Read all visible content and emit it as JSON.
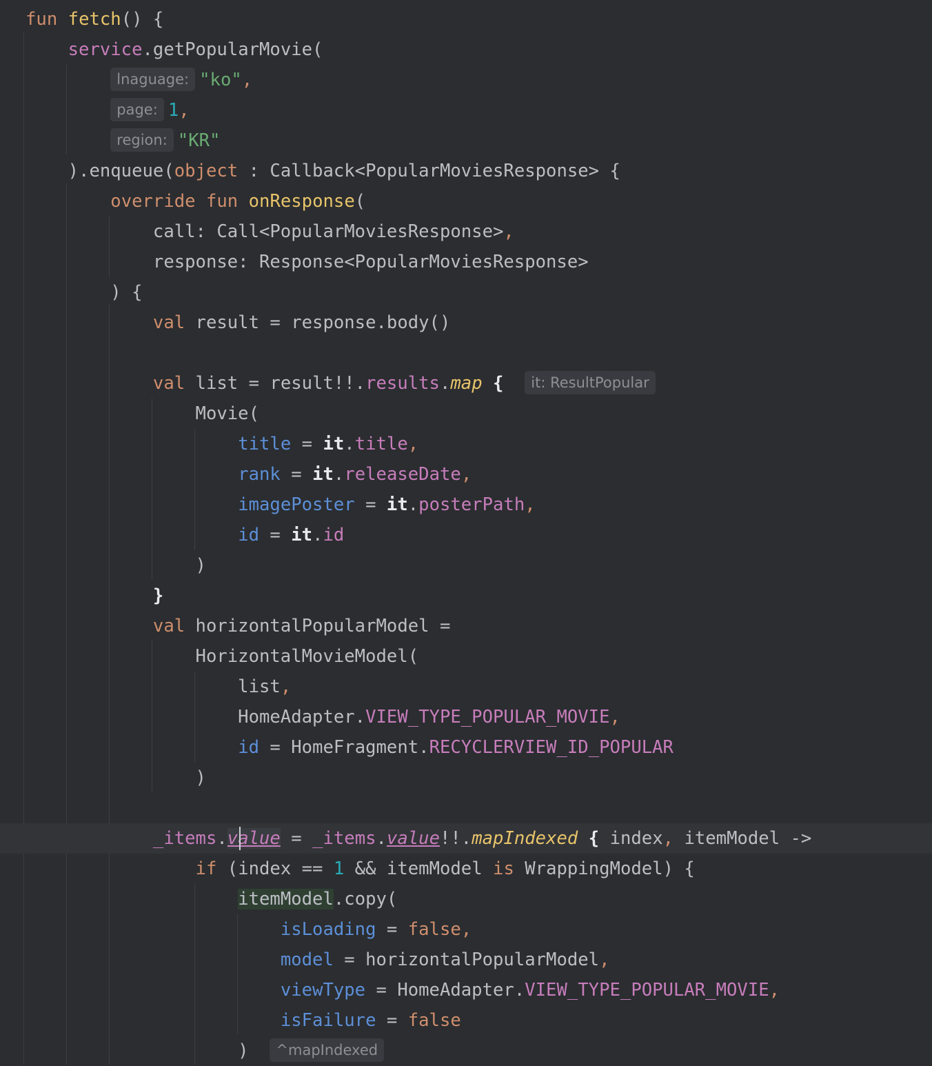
{
  "editor": {
    "language": "Kotlin",
    "theme": "dark",
    "colors": {
      "background": "#2b2d30",
      "keyword": "#cf8e6d",
      "function_declaration": "#e8c46a",
      "string": "#6aab73",
      "number": "#2aacb8",
      "property": "#c77dbb",
      "named_argument": "#5d8fd8",
      "inlay_hint_background": "#393b40"
    },
    "lines": [
      {
        "tokens": [
          {
            "t": "fun",
            "c": "k"
          },
          {
            "t": " "
          },
          {
            "t": "fetch",
            "c": "fd"
          },
          {
            "t": "() {"
          }
        ]
      },
      {
        "tokens": [
          {
            "t": "    "
          },
          {
            "t": "service",
            "c": "pp"
          },
          {
            "t": ".getPopularMovie("
          }
        ]
      },
      {
        "tokens": [
          {
            "t": "        "
          },
          {
            "t": "lnaguage:",
            "c": "hint"
          },
          {
            "t": "\"ko\"",
            "c": "s"
          },
          {
            "t": ",",
            "c": "k"
          }
        ]
      },
      {
        "tokens": [
          {
            "t": "        "
          },
          {
            "t": "page:",
            "c": "hint"
          },
          {
            "t": "1",
            "c": "n"
          },
          {
            "t": ",",
            "c": "k"
          }
        ]
      },
      {
        "tokens": [
          {
            "t": "        "
          },
          {
            "t": "region:",
            "c": "hint"
          },
          {
            "t": "\"KR\"",
            "c": "s"
          }
        ]
      },
      {
        "tokens": [
          {
            "t": "    ).enqueue("
          },
          {
            "t": "object",
            "c": "k"
          },
          {
            "t": " : Callback<PopularMoviesResponse> {"
          }
        ]
      },
      {
        "tokens": [
          {
            "t": "        "
          },
          {
            "t": "override",
            "c": "k"
          },
          {
            "t": " "
          },
          {
            "t": "fun",
            "c": "k"
          },
          {
            "t": " "
          },
          {
            "t": "onResponse",
            "c": "fd"
          },
          {
            "t": "("
          }
        ]
      },
      {
        "tokens": [
          {
            "t": "            call: Call<PopularMoviesResponse>"
          },
          {
            "t": ",",
            "c": "k"
          }
        ]
      },
      {
        "tokens": [
          {
            "t": "            response: Response<PopularMoviesResponse>"
          }
        ]
      },
      {
        "tokens": [
          {
            "t": "        ) {"
          }
        ]
      },
      {
        "tokens": [
          {
            "t": "            "
          },
          {
            "t": "val",
            "c": "k"
          },
          {
            "t": " result = response.body()"
          }
        ]
      },
      {
        "tokens": [
          {
            "t": ""
          }
        ]
      },
      {
        "tokens": [
          {
            "t": "            "
          },
          {
            "t": "val",
            "c": "k"
          },
          {
            "t": " list = result!!."
          },
          {
            "t": "results",
            "c": "pp"
          },
          {
            "t": "."
          },
          {
            "t": "map",
            "c": "ci"
          },
          {
            "t": " "
          },
          {
            "t": "{",
            "c": "it"
          },
          {
            "t": "  "
          },
          {
            "t": "it: ResultPopular",
            "c": "hint"
          }
        ]
      },
      {
        "tokens": [
          {
            "t": "                Movie("
          }
        ]
      },
      {
        "tokens": [
          {
            "t": "                    "
          },
          {
            "t": "title",
            "c": "pa"
          },
          {
            "t": " = "
          },
          {
            "t": "it",
            "c": "it"
          },
          {
            "t": "."
          },
          {
            "t": "title",
            "c": "pp"
          },
          {
            "t": ",",
            "c": "k"
          }
        ]
      },
      {
        "tokens": [
          {
            "t": "                    "
          },
          {
            "t": "rank",
            "c": "pa"
          },
          {
            "t": " = "
          },
          {
            "t": "it",
            "c": "it"
          },
          {
            "t": "."
          },
          {
            "t": "releaseDate",
            "c": "pp"
          },
          {
            "t": ",",
            "c": "k"
          }
        ]
      },
      {
        "tokens": [
          {
            "t": "                    "
          },
          {
            "t": "imagePoster",
            "c": "pa"
          },
          {
            "t": " = "
          },
          {
            "t": "it",
            "c": "it"
          },
          {
            "t": "."
          },
          {
            "t": "posterPath",
            "c": "pp"
          },
          {
            "t": ",",
            "c": "k"
          }
        ]
      },
      {
        "tokens": [
          {
            "t": "                    "
          },
          {
            "t": "id",
            "c": "pa"
          },
          {
            "t": " = "
          },
          {
            "t": "it",
            "c": "it"
          },
          {
            "t": "."
          },
          {
            "t": "id",
            "c": "pp"
          }
        ]
      },
      {
        "tokens": [
          {
            "t": "                )"
          }
        ]
      },
      {
        "tokens": [
          {
            "t": "            "
          },
          {
            "t": "}",
            "c": "it"
          }
        ]
      },
      {
        "tokens": [
          {
            "t": "            "
          },
          {
            "t": "val",
            "c": "k"
          },
          {
            "t": " horizontalPopularModel ="
          }
        ]
      },
      {
        "tokens": [
          {
            "t": "                HorizontalMovieModel("
          }
        ]
      },
      {
        "tokens": [
          {
            "t": "                    list"
          },
          {
            "t": ",",
            "c": "k"
          }
        ]
      },
      {
        "tokens": [
          {
            "t": "                    HomeAdapter."
          },
          {
            "t": "VIEW_TYPE_POPULAR_MOVIE",
            "c": "pp"
          },
          {
            "t": ",",
            "c": "k"
          }
        ]
      },
      {
        "tokens": [
          {
            "t": "                    "
          },
          {
            "t": "id",
            "c": "pa"
          },
          {
            "t": " = HomeFragment."
          },
          {
            "t": "RECYCLERVIEW_ID_POPULAR",
            "c": "pp"
          }
        ]
      },
      {
        "tokens": [
          {
            "t": "                )"
          }
        ]
      },
      {
        "tokens": [
          {
            "t": ""
          }
        ]
      },
      {
        "current": true,
        "tokens": [
          {
            "t": "            "
          },
          {
            "t": "_items",
            "c": "pp"
          },
          {
            "t": "."
          },
          {
            "t": "value",
            "c": "cu hl-read"
          },
          {
            "t": " = "
          },
          {
            "t": "_items",
            "c": "pp"
          },
          {
            "t": "."
          },
          {
            "t": "value",
            "c": "cu"
          },
          {
            "t": "!!."
          },
          {
            "t": "mapIndexed",
            "c": "ci"
          },
          {
            "t": " "
          },
          {
            "t": "{",
            "c": "it"
          },
          {
            "t": " index"
          },
          {
            "t": ",",
            "c": "k"
          },
          {
            "t": " itemModel ->"
          }
        ]
      },
      {
        "tokens": [
          {
            "t": "                "
          },
          {
            "t": "if",
            "c": "k"
          },
          {
            "t": " (index == "
          },
          {
            "t": "1",
            "c": "n"
          },
          {
            "t": " && itemModel "
          },
          {
            "t": "is",
            "c": "k"
          },
          {
            "t": " WrappingModel) {"
          }
        ]
      },
      {
        "tokens": [
          {
            "t": "                    "
          },
          {
            "t": "itemModel",
            "c": "hl-var"
          },
          {
            "t": ".copy("
          }
        ]
      },
      {
        "tokens": [
          {
            "t": "                        "
          },
          {
            "t": "isLoading",
            "c": "pa"
          },
          {
            "t": " = "
          },
          {
            "t": "false",
            "c": "k"
          },
          {
            "t": ",",
            "c": "k"
          }
        ]
      },
      {
        "tokens": [
          {
            "t": "                        "
          },
          {
            "t": "model",
            "c": "pa"
          },
          {
            "t": " = horizontalPopularModel"
          },
          {
            "t": ",",
            "c": "k"
          }
        ]
      },
      {
        "tokens": [
          {
            "t": "                        "
          },
          {
            "t": "viewType",
            "c": "pa"
          },
          {
            "t": " = HomeAdapter."
          },
          {
            "t": "VIEW_TYPE_POPULAR_MOVIE",
            "c": "pp"
          },
          {
            "t": ",",
            "c": "k"
          }
        ]
      },
      {
        "tokens": [
          {
            "t": "                        "
          },
          {
            "t": "isFailure",
            "c": "pa"
          },
          {
            "t": " = "
          },
          {
            "t": "false",
            "c": "k"
          }
        ]
      },
      {
        "tokens": [
          {
            "t": "                    )  "
          },
          {
            "t": "^mapIndexed",
            "c": "hint"
          }
        ]
      }
    ]
  }
}
